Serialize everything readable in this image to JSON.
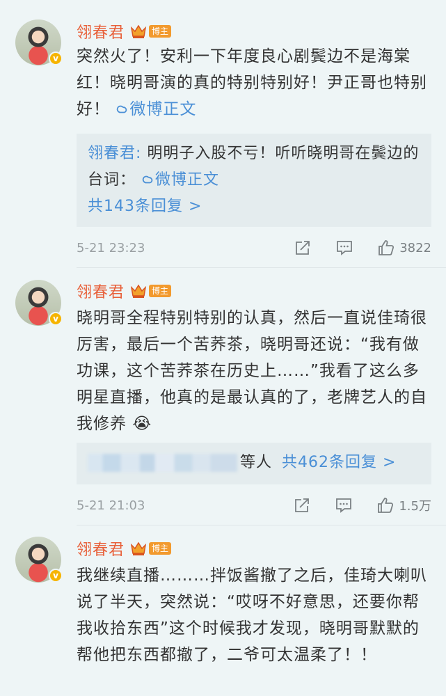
{
  "comments": [
    {
      "username": "翎春君",
      "badge": "博主",
      "text": "突然火了！安利一下年度良心剧鬓边不是海棠红！晓明哥演的真的特别特别好！尹正哥也特别好！",
      "link_label": "微博正文",
      "reply": {
        "name": "翎春君:",
        "text": " 明明子入股不亏！听听晓明哥在鬓边的台词：",
        "link_label": "微博正文",
        "count_label": "共143条回复 >"
      },
      "time": "5-21 23:23",
      "likes": "3822"
    },
    {
      "username": "翎春君",
      "badge": "博主",
      "text": "晓明哥全程特别特别的认真，然后一直说佳琦很厉害，最后一个苦荞茶，晓明哥还说：“我有做功课，这个苦荞茶在历史上……”我看了这么多明星直播，他真的是最认真的了，老牌艺人的自我修养",
      "emoji": "😭",
      "reply": {
        "others_label": "等人",
        "count_label": "共462条回复 >"
      },
      "time": "5-21 21:03",
      "likes": "1.5万"
    },
    {
      "username": "翎春君",
      "badge": "博主",
      "text": "我继续直播………拌饭酱撤了之后，佳琦大喇叭说了半天，突然说：“哎呀不好意思，还要你帮我收拾东西”这个时候我才发现，晓明哥默默的帮他把东西都撤了，二爷可太温柔了！！"
    }
  ],
  "colors": {
    "username": "#e8603a",
    "link": "#4a8fd6",
    "background": "#eef5f6"
  }
}
